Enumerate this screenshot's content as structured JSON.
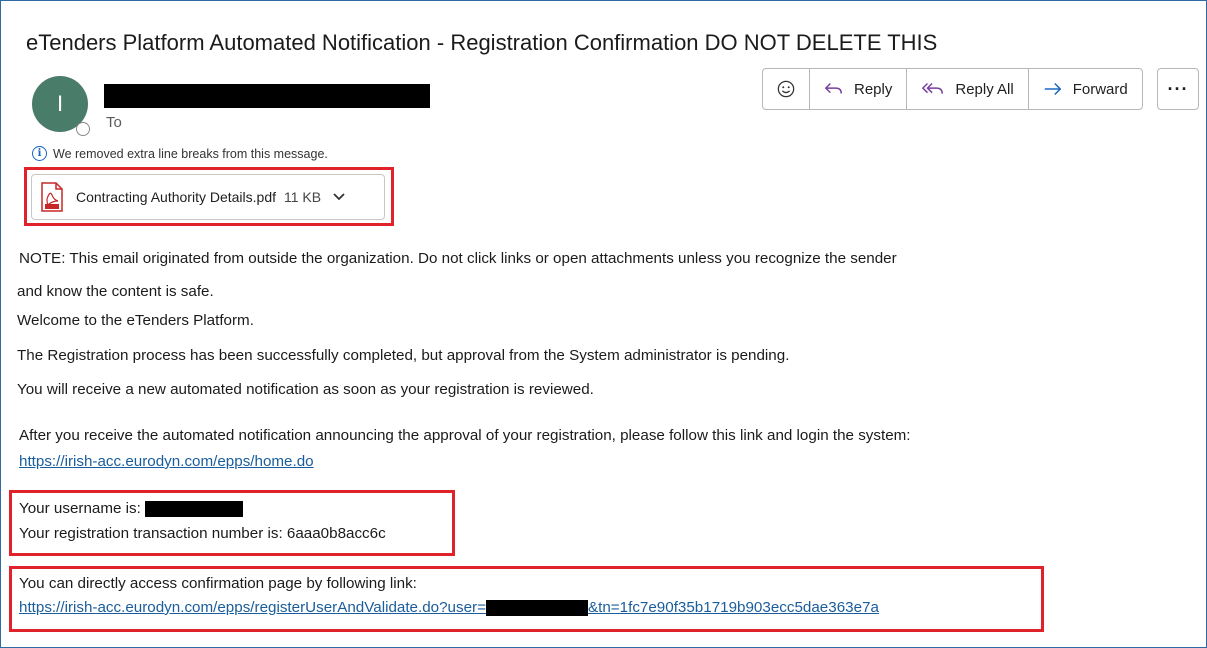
{
  "email": {
    "subject": "eTenders Platform Automated Notification - Registration Confirmation DO NOT DELETE THIS",
    "avatar_initial": "I",
    "to_label": "To",
    "info_message": "We removed extra line breaks from this message."
  },
  "toolbar": {
    "emoji_icon": "smiley-icon",
    "reply_label": "Reply",
    "reply_all_label": "Reply All",
    "forward_label": "Forward",
    "more_label": "···"
  },
  "attachment": {
    "icon": "pdf-icon",
    "filename": "Contracting Authority Details.pdf",
    "size": "11 KB"
  },
  "body": {
    "note_line1": "NOTE: This email originated from outside the organization. Do not click links or open attachments unless you recognize the sender",
    "note_line2": "and know the content is safe.",
    "welcome": "Welcome to the eTenders Platform.",
    "registration_done": "The Registration process has been successfully completed, but approval from the System administrator is pending.",
    "receive_notice": "You will receive a new automated notification as soon as your registration is reviewed.",
    "after_receive": "After you receive the automated notification announcing the approval of your registration, please follow this link and login the system:",
    "home_link": "https://irish-acc.eurodyn.com/epps/home.do",
    "username_label": "Your username is:",
    "transaction_label": "Your registration transaction number is: 6aaa0b8acc6c",
    "direct_access": "You can directly access confirmation page by following link:",
    "confirm_link_prefix": "https://irish-acc.eurodyn.com/epps/registerUserAndValidate.do?user=",
    "confirm_link_suffix": "&tn=1fc7e90f35b1719b903ecc5dae363e7a"
  },
  "colors": {
    "highlight_box": "#e0222a",
    "link": "#1a5d9c",
    "avatar": "#4a7c6a",
    "frame": "#2f6aa5"
  }
}
